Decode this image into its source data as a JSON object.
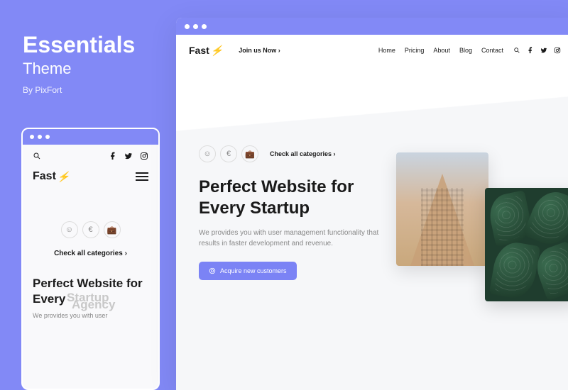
{
  "sidebar": {
    "title": "Essentials",
    "subtitle": "Theme",
    "byline": "By PixFort"
  },
  "brand": {
    "name": "Fast"
  },
  "mobile": {
    "categories_link": "Check all categories ›",
    "headline_line1": "Perfect Website for",
    "headline_line2": "Every",
    "headline_rotating1": "Startup",
    "headline_rotating2": "Agency",
    "sub": "We provides you with user"
  },
  "desktop": {
    "join_link": "Join us Now ›",
    "nav": {
      "home": "Home",
      "pricing": "Pricing",
      "about": "About",
      "blog": "Blog",
      "contact": "Contact"
    },
    "categories_link": "Check all categories ›",
    "headline": "Perfect Website for Every Startup",
    "sub": "We provides you with user management functionality that results in faster development and revenue.",
    "cta": "Acquire new customers"
  }
}
